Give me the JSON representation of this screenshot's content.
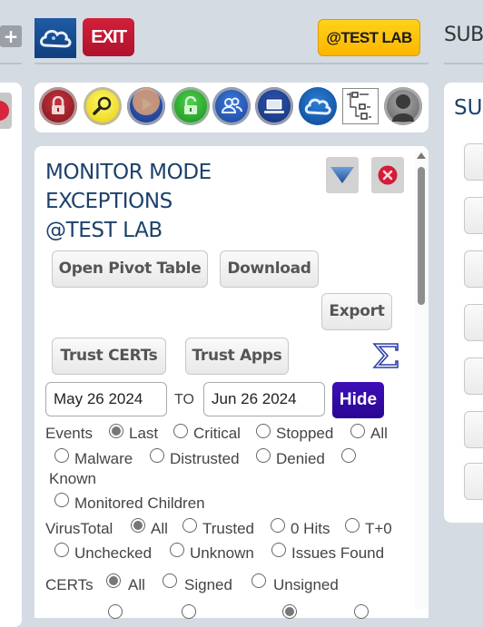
{
  "topbar": {
    "plus_label": "+",
    "exit_label": "EXIT",
    "lab_label": "@TEST LAB",
    "sub_title": "SUB"
  },
  "icons": [
    {
      "name": "lock-red-icon"
    },
    {
      "name": "search-magnifier-icon"
    },
    {
      "name": "play-icon"
    },
    {
      "name": "unlock-green-icon"
    },
    {
      "name": "users-icon"
    },
    {
      "name": "computer-icon"
    },
    {
      "name": "cloud-icon"
    },
    {
      "name": "tree-diagram-icon"
    },
    {
      "name": "user-avatar-icon"
    }
  ],
  "panel": {
    "title_line1": "MONITOR MODE",
    "title_line2": "EXCEPTIONS",
    "title_line3": "@TEST LAB",
    "buttons": {
      "open_pivot": "Open Pivot Table",
      "download": "Download",
      "export": "Export",
      "trust_certs": "Trust CERTs",
      "trust_apps": "Trust Apps",
      "hide": "Hide"
    },
    "date_from": "May 26 2024",
    "date_to_label": "TO",
    "date_to": "Jun 26 2024",
    "filters": {
      "events": {
        "label": "Events",
        "options": [
          "Last",
          "Critical",
          "Stopped",
          "All",
          "Malware",
          "Distrusted",
          "Denied",
          "Known",
          "Monitored Children"
        ],
        "selected": "Last"
      },
      "virustotal": {
        "label": "VirusTotal",
        "options": [
          "All",
          "Trusted",
          "0 Hits",
          "T+0",
          "Unchecked",
          "Unknown",
          "Issues Found"
        ],
        "selected": "All"
      },
      "certs": {
        "label": "CERTs",
        "options": [
          "All",
          "Signed",
          "Unsigned"
        ],
        "selected": "All"
      }
    }
  },
  "right_panel": {
    "title": "SU"
  }
}
